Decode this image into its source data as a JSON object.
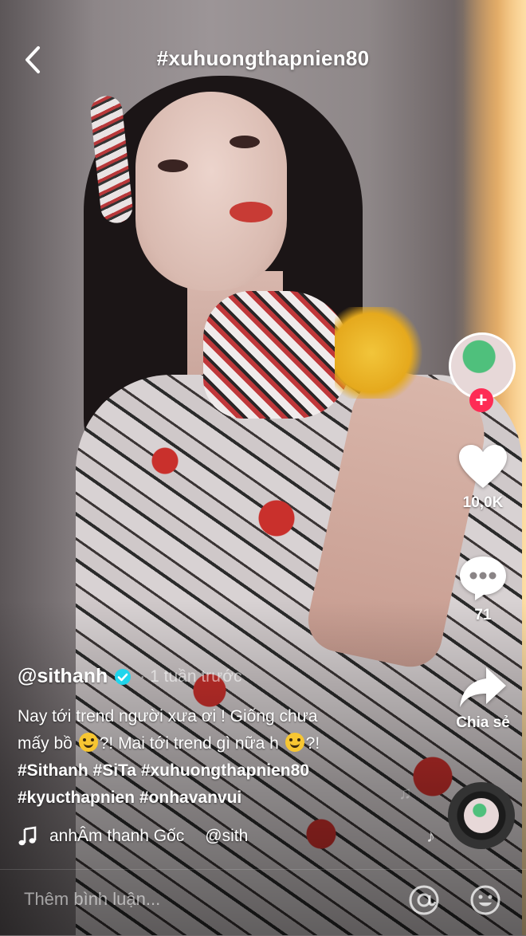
{
  "header": {
    "title": "#xuhuongthapnien80"
  },
  "rail": {
    "likes": "10,0K",
    "comments": "71",
    "share_label": "Chia sẻ"
  },
  "post": {
    "author": "@sithanh",
    "time": "1 tuần trước",
    "caption_line1": "Nay tới trend người xưa ơi ! Giống chưa",
    "caption_line2_a": "mấy bồ",
    "caption_line2_b": "?! Mai tới trend gì nữa h",
    "caption_line2_c": "?!",
    "tags_line1": "#Sithanh #SiTa #xuhuongthapnien80",
    "tags_line2": "#kyucthapnien #onhavanvui",
    "music_a": "anhÂm thanh Gốc",
    "music_b": "@sith"
  },
  "comment": {
    "placeholder": "Thêm bình luận..."
  },
  "colors": {
    "follow_plus": "#fe2c55",
    "verified": "#20d5ec"
  }
}
